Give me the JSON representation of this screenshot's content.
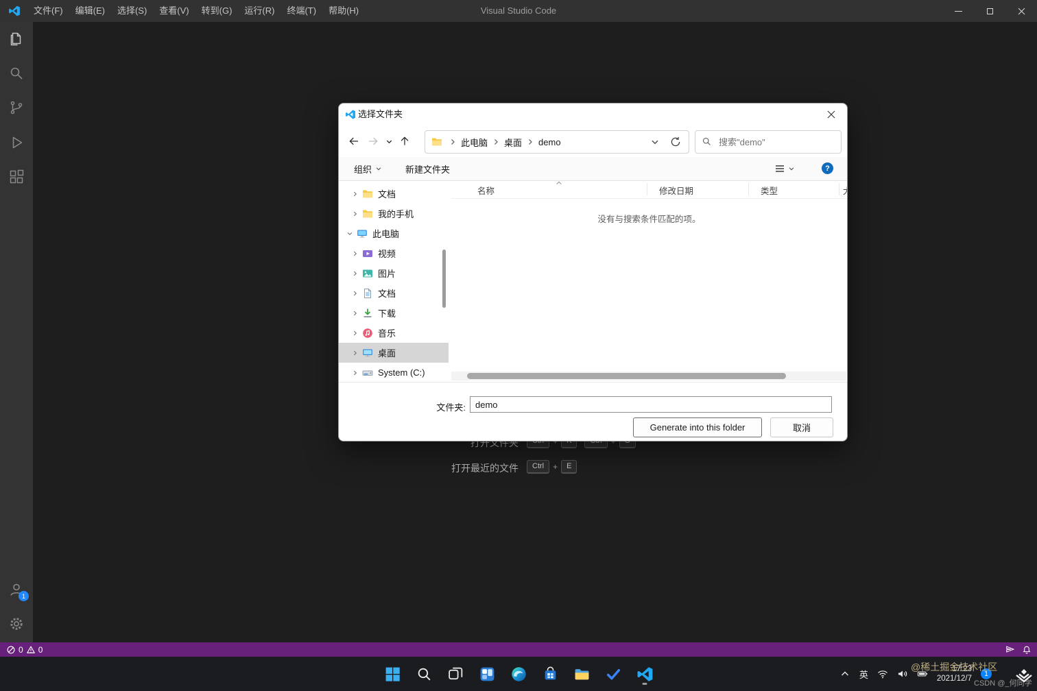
{
  "vscode": {
    "title": "Visual Studio Code",
    "menus": [
      "文件(F)",
      "编辑(E)",
      "选择(S)",
      "查看(V)",
      "转到(G)",
      "运行(R)",
      "终端(T)",
      "帮助(H)"
    ],
    "status": {
      "errors": "0",
      "warnings": "0"
    },
    "account_badge": "1",
    "welcome": {
      "open_folder_label": "打开文件夹",
      "open_folder_keys": [
        "Ctrl",
        "+",
        "K",
        "Ctrl",
        "+",
        "O"
      ],
      "open_recent_label": "打开最近的文件",
      "open_recent_keys": [
        "Ctrl",
        "+",
        "E"
      ]
    },
    "statusbar_color": "#68217A"
  },
  "dialog": {
    "title": "选择文件夹",
    "breadcrumb": [
      "此电脑",
      "桌面",
      "demo"
    ],
    "search_text": "搜索\"demo\"",
    "toolbar": {
      "organize": "组织",
      "new_folder": "新建文件夹"
    },
    "columns": {
      "name": "名称",
      "date": "修改日期",
      "type": "类型",
      "size": "大小"
    },
    "empty_message": "没有与搜索条件匹配的项。",
    "tree": [
      {
        "label": "文档",
        "icon": "folder"
      },
      {
        "label": "我的手机",
        "icon": "folder"
      },
      {
        "label": "此电脑",
        "icon": "computer",
        "expanded": true
      },
      {
        "label": "视频",
        "icon": "video"
      },
      {
        "label": "图片",
        "icon": "picture"
      },
      {
        "label": "文档",
        "icon": "document"
      },
      {
        "label": "下载",
        "icon": "download"
      },
      {
        "label": "音乐",
        "icon": "music"
      },
      {
        "label": "桌面",
        "icon": "desktop",
        "selected": true
      },
      {
        "label": "System (C:)",
        "icon": "drive"
      }
    ],
    "footer": {
      "label": "文件夹:",
      "value": "demo"
    },
    "buttons": {
      "primary": "Generate into this folder",
      "cancel": "取消"
    }
  },
  "taskbar": {
    "tray": {
      "lang": "英",
      "time": "17:23",
      "date": "2021/12/7",
      "badge": "1"
    }
  },
  "watermarks": {
    "juejin": "@稀土掘金技术社区",
    "csdn": "CSDN @_何同学"
  },
  "colors": {
    "badge_blue": "#0a84ff",
    "help_blue": "#0f6cbd"
  }
}
